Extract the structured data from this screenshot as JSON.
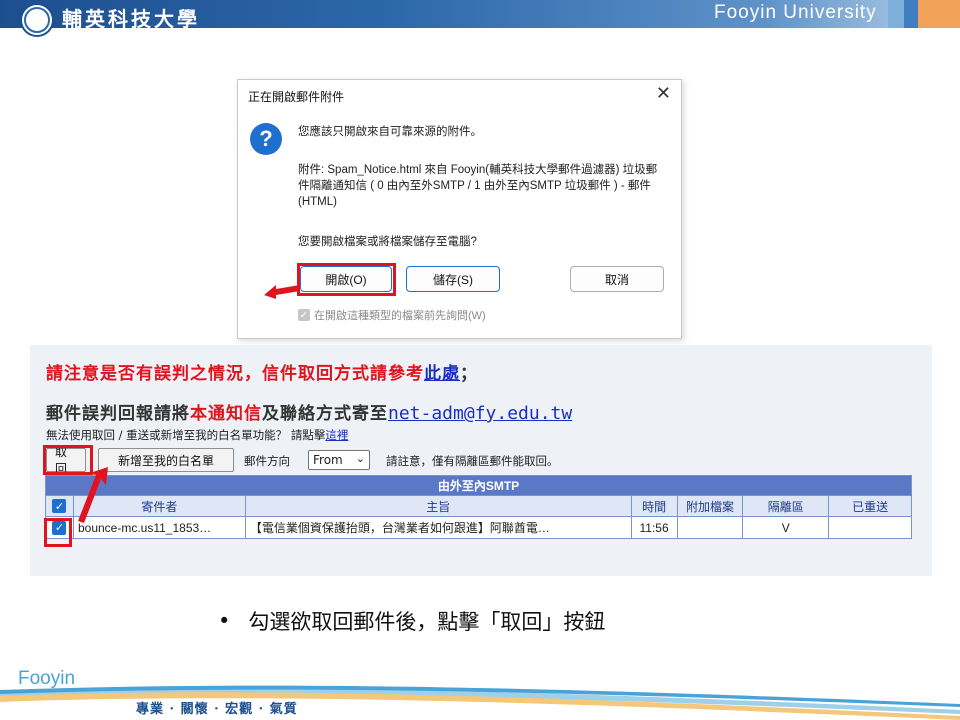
{
  "header": {
    "university_cn": "輔英科技大學",
    "university_en": "Fooyin University"
  },
  "dialog": {
    "title": "正在開啟郵件附件",
    "close_label": "✕",
    "icon": "question-icon",
    "trust_msg": "您應該只開啟來自可靠來源的附件。",
    "attachment_desc": "附件: Spam_Notice.html 來自 Fooyin(輔英科技大學郵件過濾器) 垃圾郵件隔離通知信 ( 0 由內至外SMTP / 1 由外至內SMTP 垃圾郵件 ) - 郵件 (HTML)",
    "question": "您要開啟檔案或將檔案儲存至電腦?",
    "open_button": "開啟(O)",
    "save_button": "儲存(S)",
    "cancel_button": "取消",
    "ask_checkbox": "在開啟這種類型的檔案前先詢問(W)"
  },
  "panel": {
    "notice_part1": "請注意是否有誤判之情況，信件取回方式請參考",
    "notice_link": "此處",
    "notice_end": "；",
    "report_part1": "郵件誤判回報請將",
    "report_red": "本通知信",
    "report_part2": "及聯絡方式寄至",
    "report_email": "net-adm@fy.edu.tw",
    "help_text": "無法使用取回 / 重送或新增至我的白名單功能？ 請點擊",
    "help_link": "這裡",
    "retrieve_button": "取回",
    "add_whitelist_button": "新增至我的白名單",
    "direction_label": "郵件方向",
    "direction_value": "From",
    "note": "請註意，僅有隔離區郵件能取回。",
    "table": {
      "banner": "由外至內SMTP",
      "headers": [
        "寄件者",
        "主旨",
        "時間",
        "附加檔案",
        "隔離區",
        "已重送"
      ],
      "rows": [
        {
          "checked": true,
          "sender": "bounce-mc.us11_1853…",
          "subject": "【電信業個資保護抬頭，台灣業者如何跟進】阿聯酋電…",
          "time": "11:56",
          "attachment": "",
          "quarantine": "V",
          "resent": ""
        }
      ]
    }
  },
  "bullet_text": "勾選欲取回郵件後，點擊「取回」按鈕",
  "footer": {
    "brand": "Fooyin",
    "motto": "專業 · 關懷 · 宏觀 · 氣質"
  },
  "colors": {
    "highlight_red": "#e0141e",
    "header_blue": "#1d4f8f",
    "table_banner": "#5b78c7",
    "link_blue": "#1a2fc2"
  }
}
